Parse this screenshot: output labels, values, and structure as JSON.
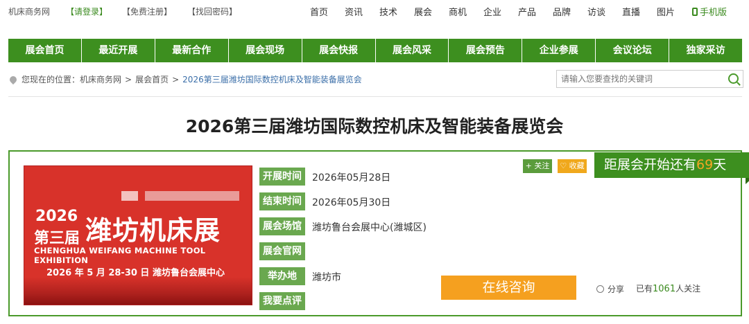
{
  "topbar": {
    "site_name": "机床商务网",
    "login": "【请登录】",
    "register": "【免费注册】",
    "recover": "【找回密码】",
    "nav": [
      "首页",
      "资讯",
      "技术",
      "展会",
      "商机",
      "企业",
      "产品",
      "品牌",
      "访谈",
      "直播",
      "图片"
    ],
    "mobile": "手机版"
  },
  "main_nav": [
    "展会首页",
    "最近开展",
    "最新合作",
    "展会现场",
    "展会快报",
    "展会风采",
    "展会预告",
    "企业参展",
    "会议论坛",
    "独家采访"
  ],
  "breadcrumb": {
    "prefix": "您现在的位置：",
    "items": [
      "机床商务网",
      "展会首页",
      "2026第三届潍坊国际数控机床及智能装备展览会"
    ],
    "separator": ">"
  },
  "search": {
    "placeholder": "请输入您要查找的关键词"
  },
  "page_title": "2026第三届潍坊国际数控机床及智能装备展览会",
  "banner": {
    "year": "2026",
    "session": "第三届",
    "title": "潍坊机床展",
    "english": "CHENGHUA WEIFANG MACHINE TOOL EXHIBITION",
    "date_place": "2026 年 5 月 28-30 日     潍坊鲁台会展中心"
  },
  "info": [
    {
      "label": "开展时间",
      "value": "2026年05月28日"
    },
    {
      "label": "结束时间",
      "value": "2026年05月30日"
    },
    {
      "label": "展会场馆",
      "value": "潍坊鲁台会展中心(潍城区)"
    },
    {
      "label": "展会官网",
      "value": ""
    },
    {
      "label": "举办地",
      "value": "潍坊市"
    },
    {
      "label": "我要点评",
      "value": ""
    }
  ],
  "actions": {
    "follow": "+ 关注",
    "favorite": "♡ 收藏",
    "consult": "在线咨询",
    "share": "分享"
  },
  "countdown": {
    "prefix": "距展会开始还有",
    "days": "69",
    "suffix": "天"
  },
  "followers": {
    "prefix": "已有",
    "count": "1061",
    "suffix": "人关注"
  },
  "colors": {
    "primary_green": "#3d8f1f",
    "label_green": "#6aa84f",
    "accent_orange": "#f5a01f"
  }
}
